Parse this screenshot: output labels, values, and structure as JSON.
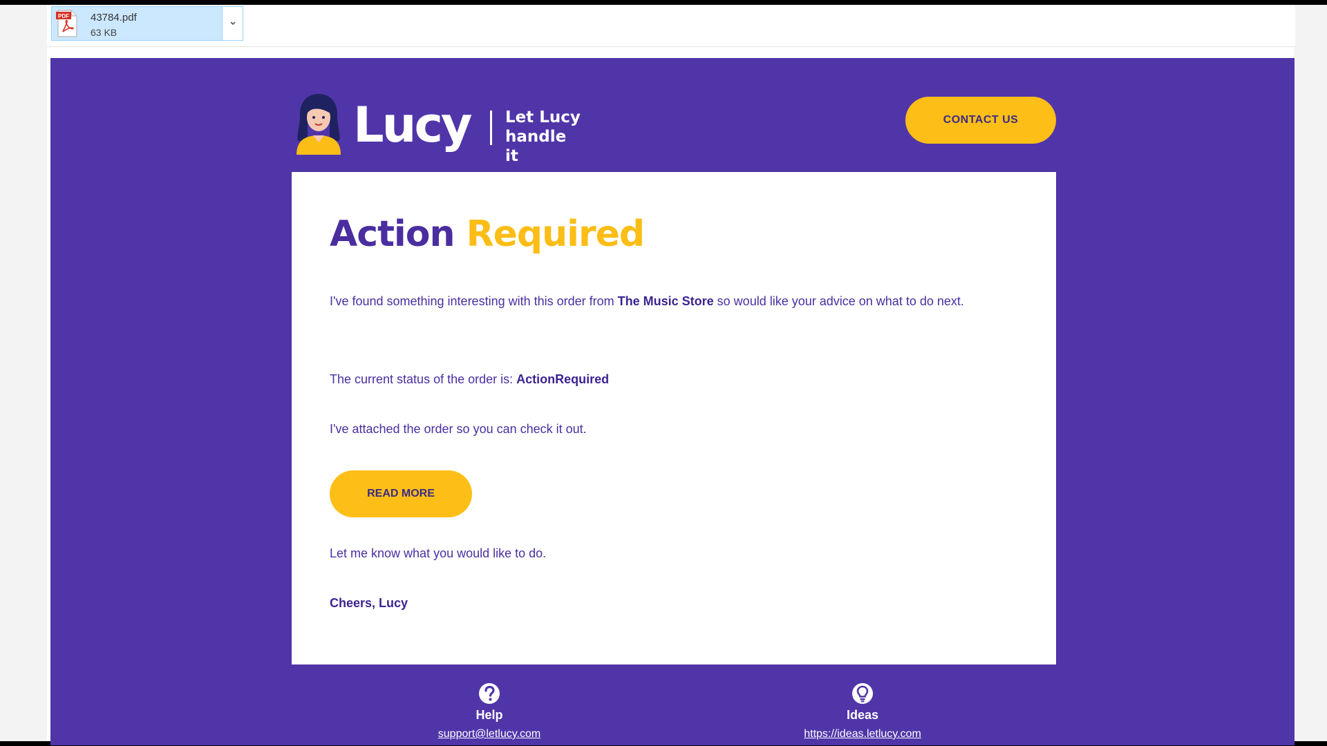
{
  "attachment": {
    "file_name": "43784.pdf",
    "file_size": "63 KB",
    "icon": "pdf-file-icon",
    "icon_label": "PDF"
  },
  "email": {
    "colors": {
      "brand_purple": "#5035a9",
      "accent_yellow": "#fdbf17",
      "text_purple": "#4a2ea0"
    },
    "header": {
      "brand_name": "Lucy",
      "tagline_line1": "Let Lucy",
      "tagline_line2": "handle it",
      "contact_button": "CONTACT US"
    },
    "card": {
      "headline_word1": "Action",
      "headline_word2": "Required",
      "p1_before": "I've found something interesting with this order from ",
      "p1_store": "The Music Store",
      "p1_after": " so would like your advice on what to do next.",
      "p2_label": "The current status of the order is: ",
      "p2_status": "ActionRequired",
      "p3": "I've attached the order so you can check it out.",
      "read_more_button": "READ MORE",
      "p4": "Let me know what you would like to do.",
      "signoff": "Cheers, Lucy"
    },
    "footer": {
      "help_icon": "question-circle-icon",
      "help_title": "Help",
      "help_link": "support@letlucy.com",
      "ideas_icon": "lightbulb-icon",
      "ideas_title": "Ideas",
      "ideas_link": "https://ideas.letlucy.com"
    }
  }
}
